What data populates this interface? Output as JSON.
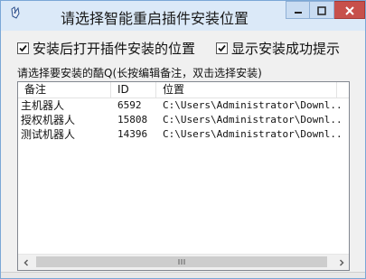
{
  "window": {
    "title": "请选择智能重启插件安装位置"
  },
  "options": {
    "open_location_after_install": {
      "label": "安装后打开插件安装的位置",
      "checked": true
    },
    "show_install_success": {
      "label": "显示安装成功提示",
      "checked": true
    }
  },
  "hint_text": "请选择要安装的酷Q(长按编辑备注，双击选择安装)",
  "table": {
    "columns": [
      "备注",
      "ID",
      "位置"
    ],
    "rows": [
      {
        "note": "主机器人",
        "id": "6592",
        "path": "C:\\Users\\Administrator\\Downl..."
      },
      {
        "note": "授权机器人",
        "id": "15808",
        "path": "C:\\Users\\Administrator\\Downl..."
      },
      {
        "note": "测试机器人",
        "id": "14396",
        "path": "C:\\Users\\Administrator\\Downl..."
      }
    ]
  },
  "scrollbar": {
    "left_icon": "chevron-left-icon",
    "right_icon": "chevron-right-icon",
    "grip_icon": "grip-icon"
  },
  "colors": {
    "titlebar": "#dbe9f8",
    "close_button": "#c7504b",
    "window_border": "#7aa7d6"
  }
}
